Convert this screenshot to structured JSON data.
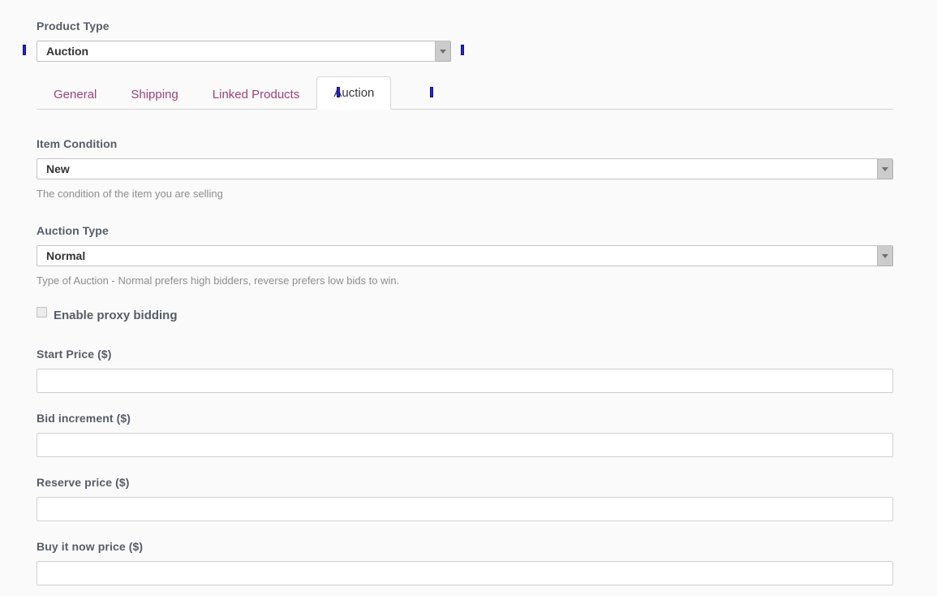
{
  "product_type": {
    "label": "Product Type",
    "value": "Auction",
    "arrow_icon": "chevron-down-icon"
  },
  "tabs": [
    {
      "label": "General",
      "active": false
    },
    {
      "label": "Shipping",
      "active": false
    },
    {
      "label": "Linked Products",
      "active": false
    },
    {
      "label": "Auction",
      "active": true
    }
  ],
  "auction_panel": {
    "item_condition": {
      "label": "Item Condition",
      "value": "New",
      "help": "The condition of the item you are selling"
    },
    "auction_type": {
      "label": "Auction Type",
      "value": "Normal",
      "help": "Type of Auction - Normal prefers high bidders, reverse prefers low bids to win."
    },
    "proxy_bidding": {
      "label": "Enable proxy bidding",
      "checked": false
    },
    "start_price": {
      "label": "Start Price ($)",
      "value": "",
      "placeholder": ""
    },
    "bid_increment": {
      "label": "Bid increment ($)",
      "value": "",
      "placeholder": ""
    },
    "reserve_price": {
      "label": "Reserve price ($)",
      "value": "",
      "placeholder": ""
    },
    "buy_it_now_price": {
      "label": "Buy it now price ($)",
      "value": "",
      "placeholder": ""
    }
  },
  "colors": {
    "page_background": "#fbfafb",
    "tab_inactive_text": "#9d3f77",
    "tab_active_text": "#3a3a3a",
    "label_text": "#565d68",
    "help_text": "#8d8d8d",
    "marker": "#2222dd"
  },
  "markers": [
    {
      "name": "selection-marker-left-of-product-type"
    },
    {
      "name": "selection-marker-right-of-product-type"
    },
    {
      "name": "selection-marker-after-linked-products-tab"
    },
    {
      "name": "selection-marker-after-auction-tab"
    }
  ]
}
